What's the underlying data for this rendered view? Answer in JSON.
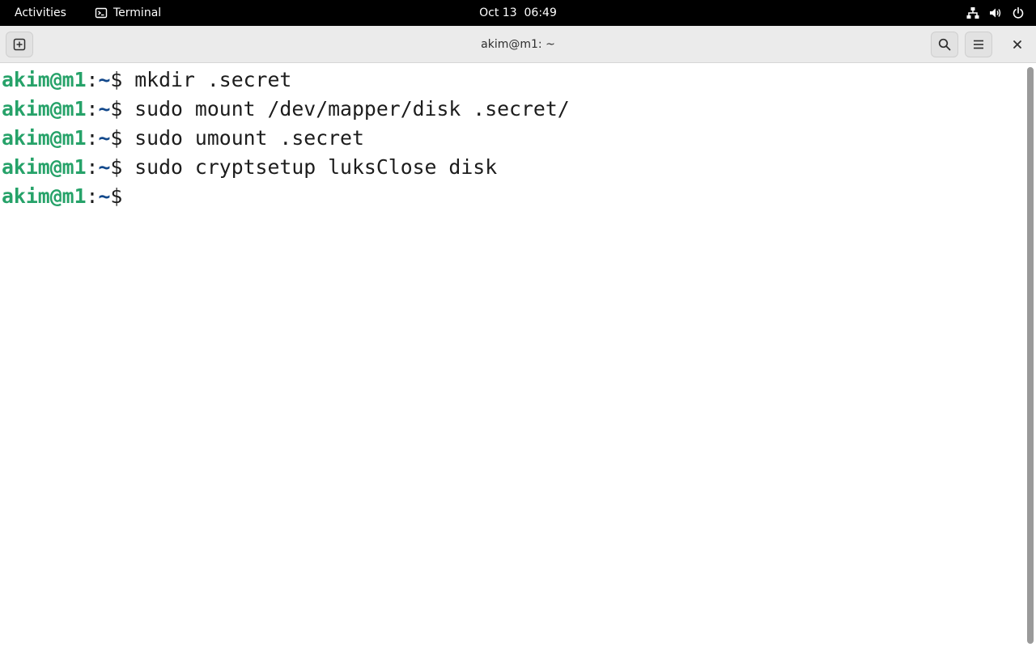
{
  "topbar": {
    "activities": "Activities",
    "app_name": "Terminal",
    "app_icon": "terminal-icon",
    "clock": "Oct 13  06:49",
    "tray_icons": [
      "network-icon",
      "volume-icon",
      "power-icon"
    ]
  },
  "window": {
    "title": "akim@m1: ~",
    "buttons": [
      "new-tab-icon",
      "search-icon",
      "menu-icon",
      "close-icon"
    ]
  },
  "terminal": {
    "lines": [
      {
        "user": "akim@m1",
        "colon": ":",
        "path": "~",
        "dollar": "$",
        "command": " mkdir .secret"
      },
      {
        "user": "akim@m1",
        "colon": ":",
        "path": "~",
        "dollar": "$",
        "command": " sudo mount /dev/mapper/disk .secret/"
      },
      {
        "user": "akim@m1",
        "colon": ":",
        "path": "~",
        "dollar": "$",
        "command": " sudo umount .secret"
      },
      {
        "user": "akim@m1",
        "colon": ":",
        "path": "~",
        "dollar": "$",
        "command": " sudo cryptsetup luksClose disk"
      },
      {
        "user": "akim@m1",
        "colon": ":",
        "path": "~",
        "dollar": "$",
        "command": ""
      }
    ]
  },
  "colors": {
    "prompt_user": "#26a269",
    "prompt_path": "#12488b",
    "terminal_text": "#1c1c1c",
    "topbar_bg": "#000000",
    "headerbar_bg": "#ebebeb"
  }
}
